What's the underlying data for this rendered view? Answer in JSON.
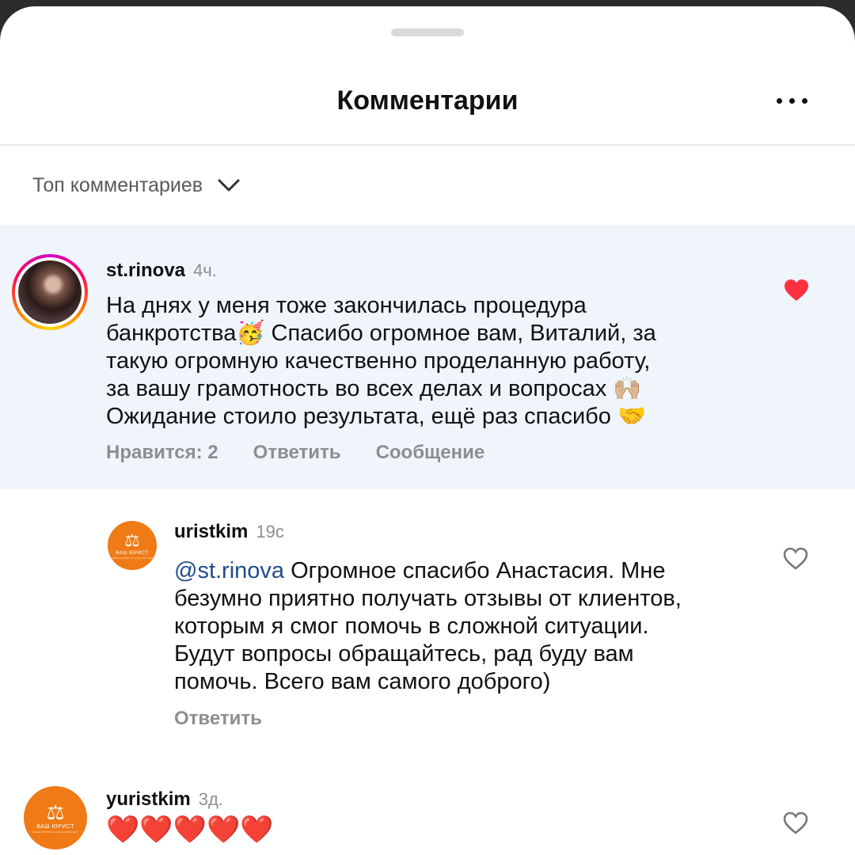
{
  "header": {
    "title": "Комментарии",
    "more_icon": "more-horizontal-icon"
  },
  "sort": {
    "label": "Топ комментариев",
    "icon": "chevron-down-icon"
  },
  "colors": {
    "highlight_bg": "#eff5fb",
    "liked_heart": "#ff3040",
    "brand_orange": "#ef7a16",
    "mention": "#1f4d8c",
    "muted": "#8e8e8e"
  },
  "comments": [
    {
      "username": "st.rinova",
      "time": "4ч.",
      "lines": [
        "На днях у меня тоже закончилась процедура",
        "банкротства🥳 Спасибо огромное вам, Виталий, за",
        "такую огромную качественно проделанную работу,",
        "за вашу грамотность во всех делах и вопросах 🙌🏼",
        "Ожидание стоило результата, ещё раз спасибо 🤝"
      ],
      "likes_label": "Нравится: 2",
      "reply_label": "Ответить",
      "message_label": "Сообщение",
      "liked": true
    },
    {
      "username": "uristkim",
      "time": "19с",
      "mention": "@st.rinova",
      "lines": [
        "Огромное спасибо Анастасия. Мне",
        "безумно приятно получать отзывы от клиентов,",
        "которым я смог помочь в сложной ситуации.",
        "Будут вопросы обращайтесь, рад буду вам",
        "помочь. Всего вам самого доброго)"
      ],
      "reply_label": "Ответить",
      "liked": false,
      "avatar_text": "ВАШ ЮРИСТ",
      "avatar_tagline": "БАНКРОТСТВО И КОНСУЛЬТАЦИИ"
    },
    {
      "username": "yuristkim",
      "time": "3д.",
      "text": "❤️❤️❤️❤️❤️",
      "liked": false,
      "avatar_text": "ВАШ ЮРИСТ",
      "avatar_tagline": "БАНКРОТСТВО И КОНСУЛЬТАЦИИ"
    }
  ]
}
